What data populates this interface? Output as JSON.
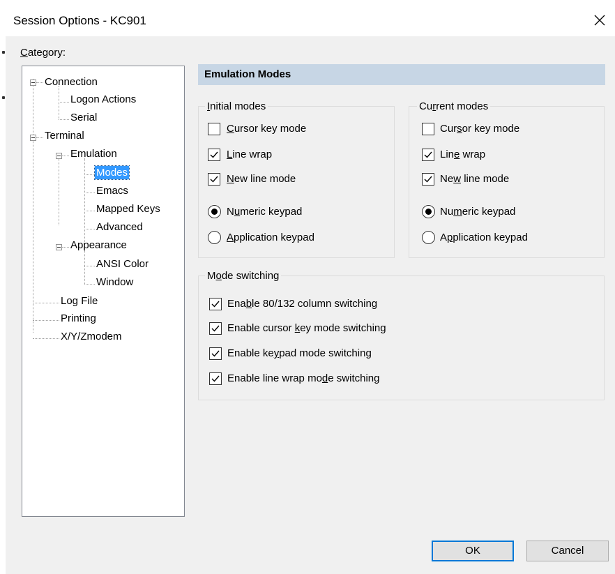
{
  "window": {
    "title": "Session Options - KC901",
    "close_icon": "close-icon"
  },
  "category": {
    "label_prefix": "",
    "label_access": "C",
    "label_rest": "ategory:",
    "tree": {
      "connection": "Connection",
      "logon_actions": "Logon Actions",
      "serial": "Serial",
      "terminal": "Terminal",
      "emulation": "Emulation",
      "modes": "Modes",
      "emacs": "Emacs",
      "mapped_keys": "Mapped Keys",
      "advanced": "Advanced",
      "appearance": "Appearance",
      "ansi_color": "ANSI Color",
      "window": "Window",
      "log_file": "Log File",
      "printing": "Printing",
      "xyzmodem": "X/Y/Zmodem"
    }
  },
  "panel": {
    "header": "Emulation Modes",
    "initial": {
      "title_access": "I",
      "title_rest": "nitial modes",
      "cursor_key": {
        "pre": "",
        "acc": "C",
        "post": "ursor key mode",
        "checked": false
      },
      "line_wrap": {
        "pre": "",
        "acc": "L",
        "post": "ine wrap",
        "checked": true
      },
      "new_line": {
        "pre": "",
        "acc": "N",
        "post": "ew line mode",
        "checked": true
      },
      "numeric": {
        "pre": "N",
        "acc": "u",
        "post": "meric keypad",
        "selected": true
      },
      "application": {
        "pre": "",
        "acc": "A",
        "post": "pplication keypad",
        "selected": false
      }
    },
    "current": {
      "title_pre": "Cu",
      "title_access": "r",
      "title_rest": "rent modes",
      "cursor_key": {
        "pre": "Cur",
        "acc": "s",
        "post": "or key mode",
        "checked": false
      },
      "line_wrap": {
        "pre": "Lin",
        "acc": "e",
        "post": " wrap",
        "checked": true
      },
      "new_line": {
        "pre": "Ne",
        "acc": "w",
        "post": " line mode",
        "checked": true
      },
      "numeric": {
        "pre": "Nu",
        "acc": "m",
        "post": "eric keypad",
        "selected": true
      },
      "application": {
        "pre": "A",
        "acc": "p",
        "post": "plication keypad",
        "selected": false
      }
    },
    "switching": {
      "title_pre": "M",
      "title_access": "o",
      "title_rest": "de switching",
      "col_switch": {
        "pre": "Ena",
        "acc": "b",
        "post": "le 80/132 column switching",
        "checked": true
      },
      "cursor_switch": {
        "pre": "Enable cursor ",
        "acc": "k",
        "post": "ey mode switching",
        "checked": true
      },
      "keypad_switch": {
        "pre": "Enable ke",
        "acc": "y",
        "post": "pad mode switching",
        "checked": true
      },
      "wrap_switch": {
        "pre": "Enable line wrap mo",
        "acc": "d",
        "post": "e switching",
        "checked": true
      }
    }
  },
  "buttons": {
    "ok": "OK",
    "cancel": "Cancel"
  }
}
